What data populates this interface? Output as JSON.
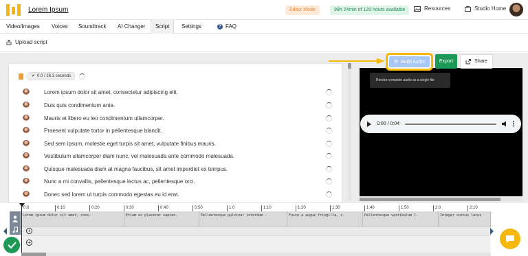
{
  "header": {
    "project_title": "Lorem Ipsum",
    "editor_mode": "Editor Mode",
    "time_available": "99h 24min of 120 hours available",
    "resources": "Resources",
    "studio_home": "Studio Home"
  },
  "nav": {
    "tabs": [
      "Video/Images",
      "Voices",
      "Soundtrack",
      "AI Changer",
      "Script",
      "Settings"
    ],
    "active_tab": "Script",
    "faq": "FAQ"
  },
  "toolbar": {
    "upload_script": "Upload script"
  },
  "script": {
    "duration": "0.0 / 26.3 seconds",
    "lines": [
      "Lorem ipsum dolor sit amet, consectetur adipiscing elit.",
      "Duis quis condimentum ante.",
      "Mauris et libero eu leo condimentum ullamcorper.",
      "Praesent vulputate tortor in pellentesque blandit.",
      "Sed sem ipsum, molestie eget turpis sit amet, vulputate finibus mauris.",
      "Vestibulum ullamcorper diam nunc, vel malesuada ante commodo malesuada.",
      "Quisque malesuada diam at magna faucibus, sit amet imperdiet ex tempus.",
      "Nunc a mi convallis, pellentesque lectus ac, pellentesque orci.",
      "Donec sed lorem ut turpis commodo egestas eu id erat."
    ]
  },
  "actions": {
    "build_audio": "Build Audio",
    "build_audio_tooltip": "Render complete audio as a single file",
    "export": "Export",
    "share": "Share"
  },
  "player": {
    "time": "0:00 / 0:04"
  },
  "timeline": {
    "ticks": [
      "0:0",
      "0:10",
      "0:20",
      "0:30",
      "0:40",
      "0:50",
      "1:0",
      "1:10",
      "1:20",
      "1:30",
      "1:40",
      "1:50",
      "2:0",
      "2:10"
    ],
    "clips": [
      "Lorem ipsum dolor sit amet, cons-",
      "Etiam ac placerat sapien.",
      "Pellentesque pulvinar interdum -",
      "Fusce a augue fringilla, c-",
      "Pellentesque vestibulum l-",
      "Integer cursus lacus"
    ]
  },
  "colors": {
    "highlight": "#f5b70a",
    "export_green": "#1b9955",
    "build_blue": "#a9c7f3"
  }
}
